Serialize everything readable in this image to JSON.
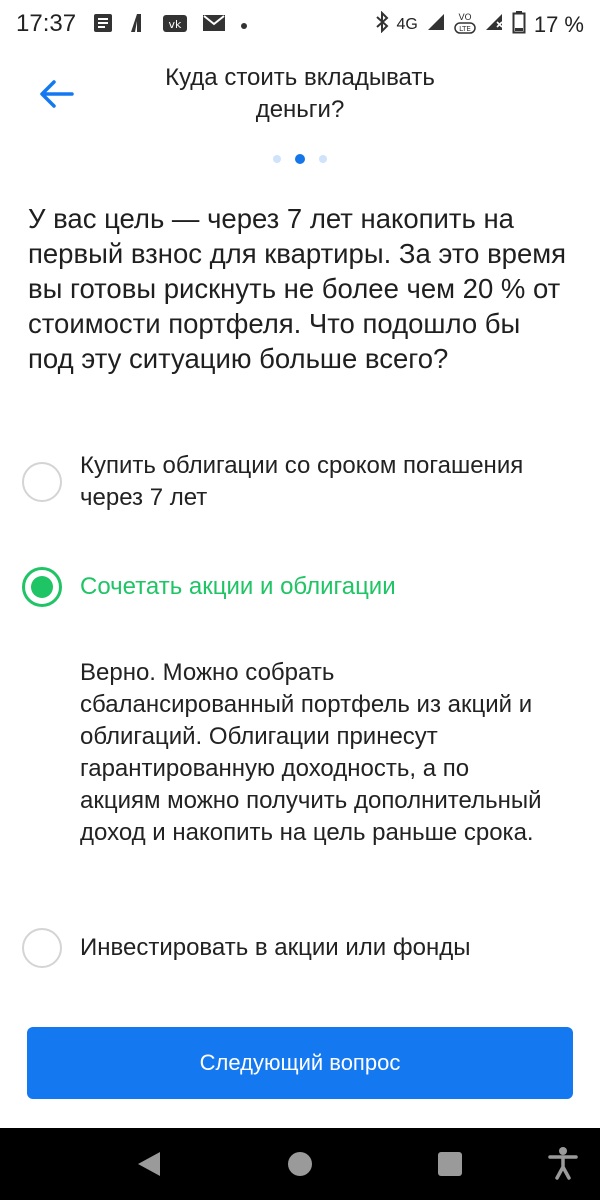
{
  "status_bar": {
    "time": "17:37",
    "network": "4G",
    "volte": "VoLTE",
    "battery": "17 %",
    "icons": [
      "notes-icon",
      "app-l-icon",
      "vk-icon",
      "mail-icon",
      "dot-icon",
      "bluetooth-icon",
      "signal-icon",
      "signal-icon",
      "battery-icon"
    ]
  },
  "header": {
    "title": "Куда стоить вкладывать деньги?"
  },
  "progress": {
    "total": 3,
    "current": 2
  },
  "question": "У вас цель — через 7 лет накопить на первый взнос для квартиры. За это время вы готовы рискнуть не более чем 20 % от стоимости портфеля. Что подошло бы под эту ситуацию больше всего?",
  "options": [
    {
      "label": "Купить облигации со сроком погашения через 7 лет",
      "selected": false
    },
    {
      "label": "Сочетать акции и облигации",
      "selected": true
    },
    {
      "label": "Инвестировать в акции или фонды",
      "selected": false
    }
  ],
  "explanation": "Верно. Можно собрать сбалансированный портфель из акций и облигаций. Облигации принесут гарантированную доходность, а по акциям можно получить дополнительный доход и накопить на цель раньше срока.",
  "next_button": {
    "label": "Следующий вопрос"
  },
  "colors": {
    "accent_blue": "#1478f0",
    "correct_green": "#1fc465",
    "dot_inactive": "#cfe3fb",
    "dot_active": "#1476e8"
  }
}
